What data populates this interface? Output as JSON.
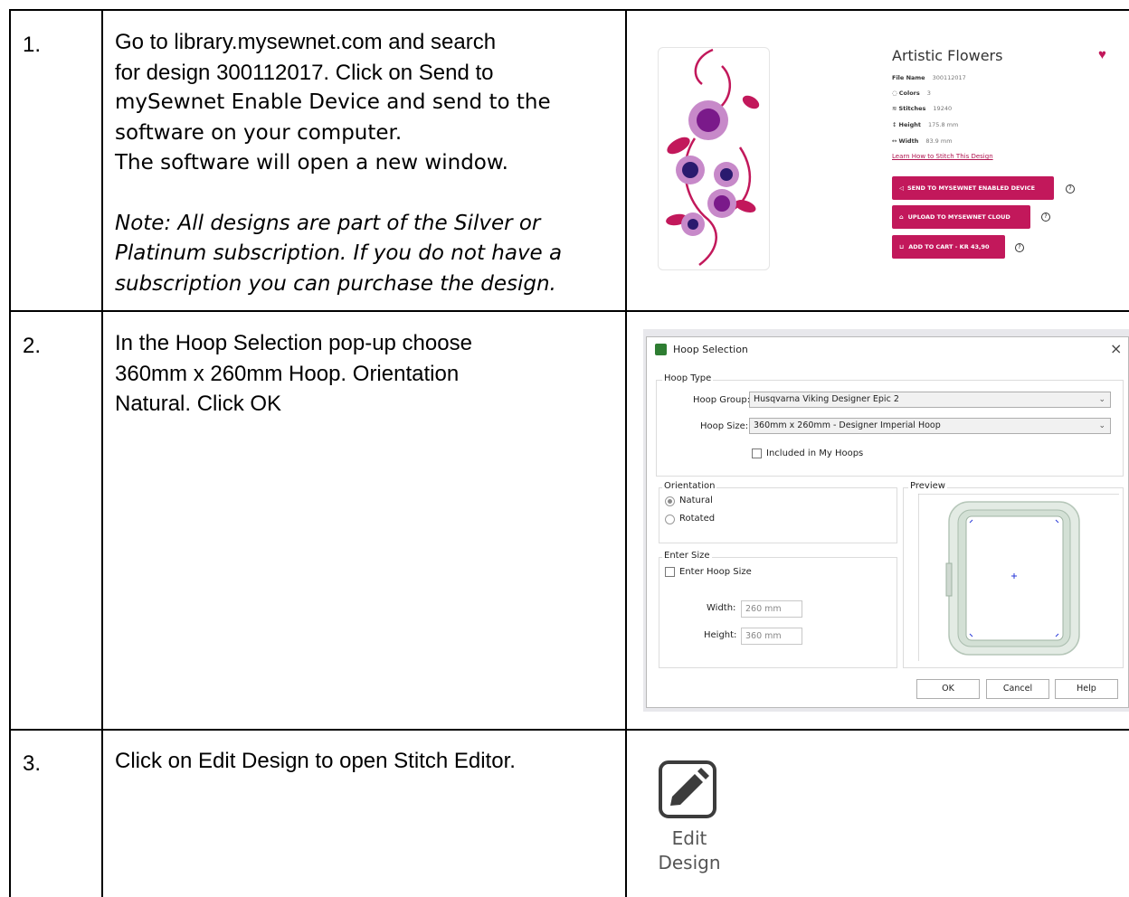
{
  "steps": [
    {
      "number": "1.",
      "lines": [
        "Go to library.mysewnet.com and search",
        "for design 300112017.  Click on Send to",
        "mySewnet Enable Device and send to the",
        "software on your computer.",
        "The software will open a new window."
      ],
      "note_lines": [
        "Note: All designs are part of the Silver or",
        "Platinum subscription. If you do not have a",
        "subscription you can purchase the design."
      ]
    },
    {
      "number": "2.",
      "lines": [
        "In the Hoop Selection pop-up choose",
        "360mm x 260mm Hoop. Orientation",
        "Natural. Click OK"
      ]
    },
    {
      "number": "3.",
      "lines": [
        "Click on Edit Design to open Stitch Editor."
      ]
    }
  ],
  "product": {
    "title": "Artistic Flowers",
    "file_name_label": "File Name",
    "file_name": "300112017",
    "colors_label": "Colors",
    "colors": "3",
    "stitches_label": "Stitches",
    "stitches": "19240",
    "height_label": "Height",
    "height": "175.8 mm",
    "width_label": "Width",
    "width": "83.9 mm",
    "learn_link": "Learn How to Stitch This Design",
    "btn_send": "SEND TO MYSEWNET ENABLED DEVICE",
    "btn_upload": "UPLOAD TO MYSEWNET CLOUD",
    "btn_cart": "ADD TO CART - KR 43,90",
    "accent": "#c2185b"
  },
  "dialog": {
    "title": "Hoop Selection",
    "hoop_type_label": "Hoop Type",
    "hoop_group_label": "Hoop Group:",
    "hoop_group_value": "Husqvarna Viking Designer Epic 2",
    "hoop_size_label": "Hoop Size:",
    "hoop_size_value": "360mm x 260mm - Designer Imperial Hoop",
    "included_label": "Included in My Hoops",
    "orientation_label": "Orientation",
    "natural_label": "Natural",
    "rotated_label": "Rotated",
    "enter_size_group": "Enter Size",
    "enter_hoop_size_label": "Enter Hoop Size",
    "width_label": "Width:",
    "width_value": "260 mm",
    "height_label": "Height:",
    "height_value": "360 mm",
    "preview_label": "Preview",
    "ok": "OK",
    "cancel": "Cancel",
    "help": "Help",
    "close": "×"
  },
  "edit_design": {
    "line1": "Edit",
    "line2": "Design"
  }
}
